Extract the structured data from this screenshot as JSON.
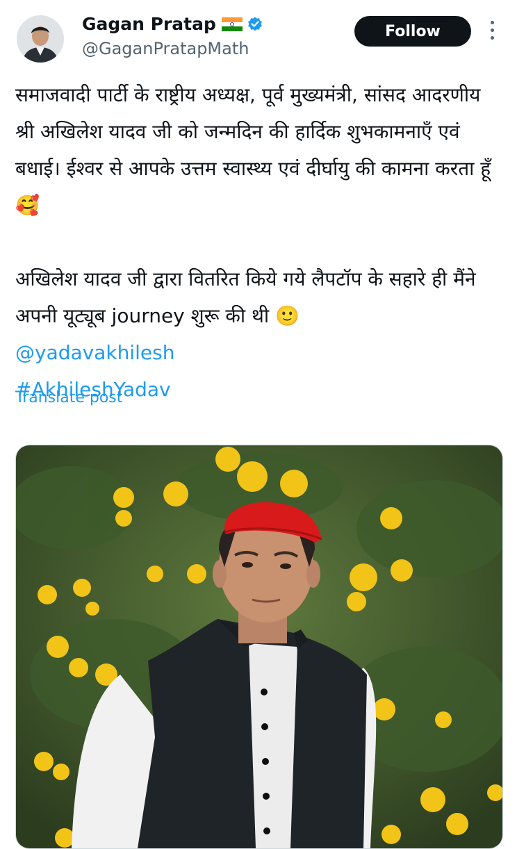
{
  "author": {
    "name": "Gagan Pratap",
    "handle": "@GaganPratapMath",
    "flag_icon": "india-flag-icon",
    "verified_icon": "verified-badge-icon",
    "verified_color": "#1d9bf0"
  },
  "actions": {
    "follow_label": "Follow",
    "more_icon": "more-vertical-icon"
  },
  "post": {
    "paragraph1": "समाजवादी पार्टी के राष्ट्रीय अध्यक्ष, पूर्व मुख्यमंत्री, सांसद आदरणीय श्री अखिलेश यादव जी को जन्मदिन की हार्दिक शुभकामनाएँ एवं बधाई। ईश्वर से आपके उत्तम स्वास्थ्य एवं दीर्घायु की कामना करता हूँ🥰",
    "paragraph2": "अखिलेश यादव जी द्वारा वितरित किये गये लैपटॉप के सहारे ही मैंने अपनी यूट्यूब journey शुरू की थी 🙂",
    "mention": "@yadavakhilesh",
    "hashtag": "#AkhileshYadav",
    "translate_label": "Translate post"
  },
  "colors": {
    "link": "#1d9bf0",
    "text": "#0f1419",
    "secondary": "#536471",
    "cap_red": "#d81a1a"
  }
}
